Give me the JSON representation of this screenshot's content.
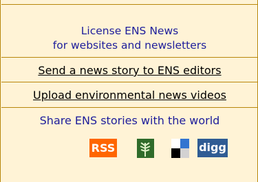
{
  "license": {
    "line1": "License ENS News",
    "line2": "for websites and newsletters"
  },
  "send_link": "Send a news story to ENS editors",
  "upload_link": "Upload environmental news videos",
  "share": {
    "title": "Share ENS stories with the world",
    "icons": {
      "rss": "RSS",
      "digg": "digg",
      "plant_icon": "plant-icon",
      "delicious_icon": "delicious-icon"
    }
  },
  "colors": {
    "background": "#fff3d6",
    "border": "#b8860b",
    "blue_text": "#1d1d9b",
    "rss_orange": "#ff6600",
    "digg_blue": "#2f5c94"
  }
}
